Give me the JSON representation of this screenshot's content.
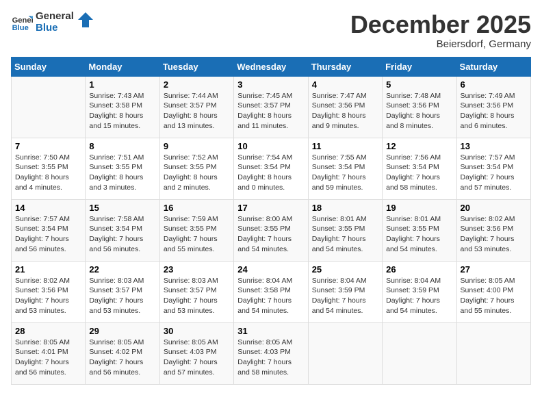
{
  "header": {
    "logo_line1": "General",
    "logo_line2": "Blue",
    "month": "December 2025",
    "location": "Beiersdorf, Germany"
  },
  "weekdays": [
    "Sunday",
    "Monday",
    "Tuesday",
    "Wednesday",
    "Thursday",
    "Friday",
    "Saturday"
  ],
  "weeks": [
    [
      {
        "day": "",
        "info": ""
      },
      {
        "day": "1",
        "info": "Sunrise: 7:43 AM\nSunset: 3:58 PM\nDaylight: 8 hours\nand 15 minutes."
      },
      {
        "day": "2",
        "info": "Sunrise: 7:44 AM\nSunset: 3:57 PM\nDaylight: 8 hours\nand 13 minutes."
      },
      {
        "day": "3",
        "info": "Sunrise: 7:45 AM\nSunset: 3:57 PM\nDaylight: 8 hours\nand 11 minutes."
      },
      {
        "day": "4",
        "info": "Sunrise: 7:47 AM\nSunset: 3:56 PM\nDaylight: 8 hours\nand 9 minutes."
      },
      {
        "day": "5",
        "info": "Sunrise: 7:48 AM\nSunset: 3:56 PM\nDaylight: 8 hours\nand 8 minutes."
      },
      {
        "day": "6",
        "info": "Sunrise: 7:49 AM\nSunset: 3:56 PM\nDaylight: 8 hours\nand 6 minutes."
      }
    ],
    [
      {
        "day": "7",
        "info": "Sunrise: 7:50 AM\nSunset: 3:55 PM\nDaylight: 8 hours\nand 4 minutes."
      },
      {
        "day": "8",
        "info": "Sunrise: 7:51 AM\nSunset: 3:55 PM\nDaylight: 8 hours\nand 3 minutes."
      },
      {
        "day": "9",
        "info": "Sunrise: 7:52 AM\nSunset: 3:55 PM\nDaylight: 8 hours\nand 2 minutes."
      },
      {
        "day": "10",
        "info": "Sunrise: 7:54 AM\nSunset: 3:54 PM\nDaylight: 8 hours\nand 0 minutes."
      },
      {
        "day": "11",
        "info": "Sunrise: 7:55 AM\nSunset: 3:54 PM\nDaylight: 7 hours\nand 59 minutes."
      },
      {
        "day": "12",
        "info": "Sunrise: 7:56 AM\nSunset: 3:54 PM\nDaylight: 7 hours\nand 58 minutes."
      },
      {
        "day": "13",
        "info": "Sunrise: 7:57 AM\nSunset: 3:54 PM\nDaylight: 7 hours\nand 57 minutes."
      }
    ],
    [
      {
        "day": "14",
        "info": "Sunrise: 7:57 AM\nSunset: 3:54 PM\nDaylight: 7 hours\nand 56 minutes."
      },
      {
        "day": "15",
        "info": "Sunrise: 7:58 AM\nSunset: 3:54 PM\nDaylight: 7 hours\nand 56 minutes."
      },
      {
        "day": "16",
        "info": "Sunrise: 7:59 AM\nSunset: 3:55 PM\nDaylight: 7 hours\nand 55 minutes."
      },
      {
        "day": "17",
        "info": "Sunrise: 8:00 AM\nSunset: 3:55 PM\nDaylight: 7 hours\nand 54 minutes."
      },
      {
        "day": "18",
        "info": "Sunrise: 8:01 AM\nSunset: 3:55 PM\nDaylight: 7 hours\nand 54 minutes."
      },
      {
        "day": "19",
        "info": "Sunrise: 8:01 AM\nSunset: 3:55 PM\nDaylight: 7 hours\nand 54 minutes."
      },
      {
        "day": "20",
        "info": "Sunrise: 8:02 AM\nSunset: 3:56 PM\nDaylight: 7 hours\nand 53 minutes."
      }
    ],
    [
      {
        "day": "21",
        "info": "Sunrise: 8:02 AM\nSunset: 3:56 PM\nDaylight: 7 hours\nand 53 minutes."
      },
      {
        "day": "22",
        "info": "Sunrise: 8:03 AM\nSunset: 3:57 PM\nDaylight: 7 hours\nand 53 minutes."
      },
      {
        "day": "23",
        "info": "Sunrise: 8:03 AM\nSunset: 3:57 PM\nDaylight: 7 hours\nand 53 minutes."
      },
      {
        "day": "24",
        "info": "Sunrise: 8:04 AM\nSunset: 3:58 PM\nDaylight: 7 hours\nand 54 minutes."
      },
      {
        "day": "25",
        "info": "Sunrise: 8:04 AM\nSunset: 3:59 PM\nDaylight: 7 hours\nand 54 minutes."
      },
      {
        "day": "26",
        "info": "Sunrise: 8:04 AM\nSunset: 3:59 PM\nDaylight: 7 hours\nand 54 minutes."
      },
      {
        "day": "27",
        "info": "Sunrise: 8:05 AM\nSunset: 4:00 PM\nDaylight: 7 hours\nand 55 minutes."
      }
    ],
    [
      {
        "day": "28",
        "info": "Sunrise: 8:05 AM\nSunset: 4:01 PM\nDaylight: 7 hours\nand 56 minutes."
      },
      {
        "day": "29",
        "info": "Sunrise: 8:05 AM\nSunset: 4:02 PM\nDaylight: 7 hours\nand 56 minutes."
      },
      {
        "day": "30",
        "info": "Sunrise: 8:05 AM\nSunset: 4:03 PM\nDaylight: 7 hours\nand 57 minutes."
      },
      {
        "day": "31",
        "info": "Sunrise: 8:05 AM\nSunset: 4:03 PM\nDaylight: 7 hours\nand 58 minutes."
      },
      {
        "day": "",
        "info": ""
      },
      {
        "day": "",
        "info": ""
      },
      {
        "day": "",
        "info": ""
      }
    ]
  ]
}
